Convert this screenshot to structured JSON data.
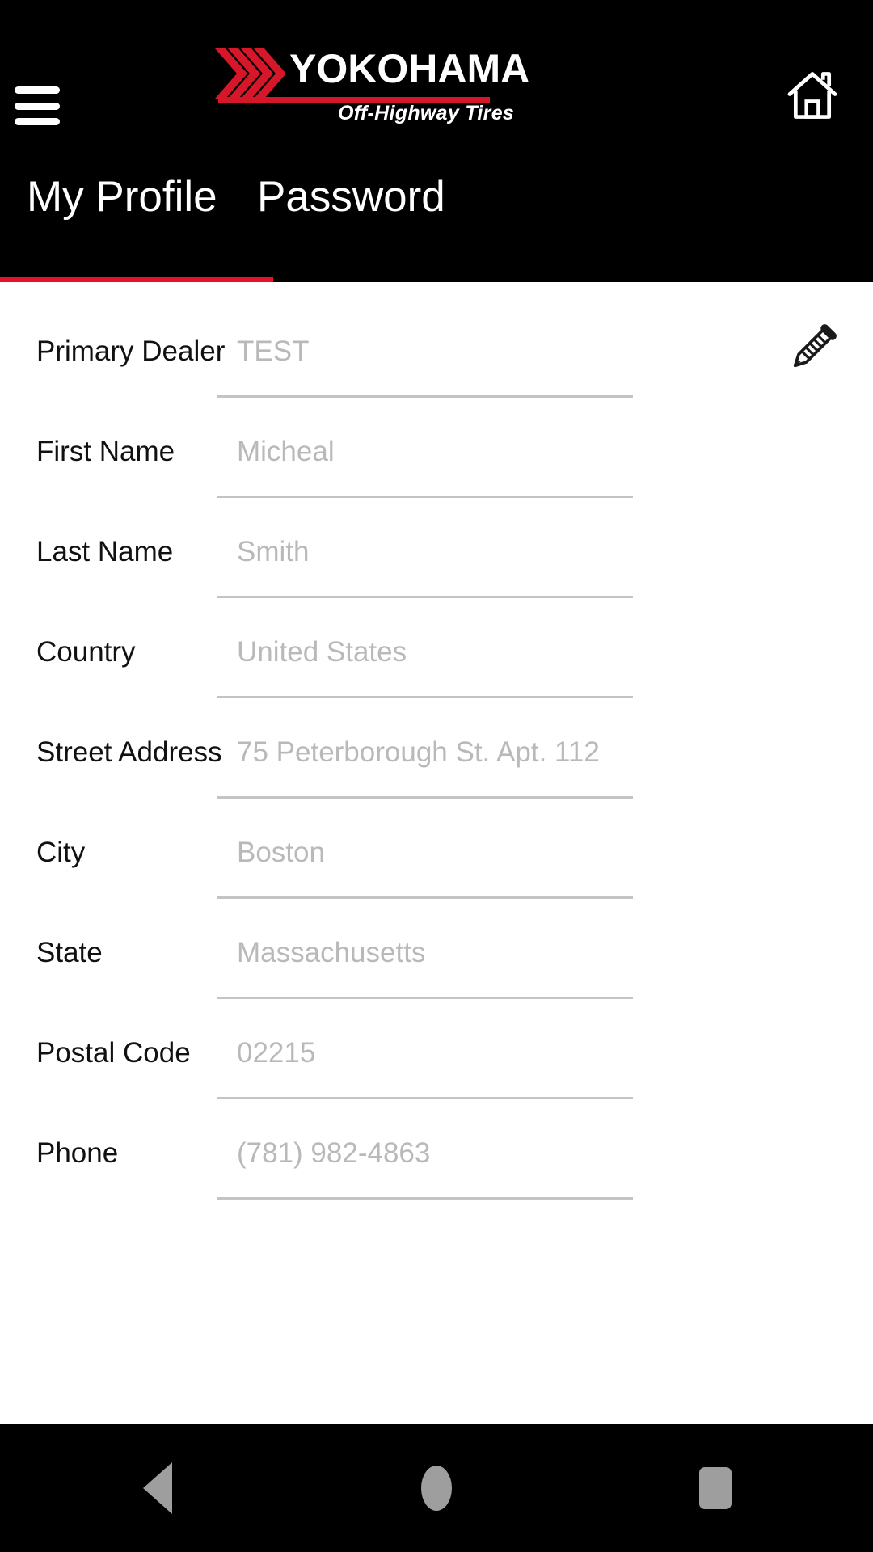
{
  "header": {
    "menu_icon": "hamburger-menu-icon",
    "home_icon": "home-icon",
    "logo": {
      "wordmark": "YOKOHAMA",
      "tagline": "Off-Highway Tires",
      "mark_color": "#d6172a"
    }
  },
  "tabs": {
    "items": [
      {
        "label": "My Profile",
        "active": true
      },
      {
        "label": "Password",
        "active": false
      }
    ],
    "indicator_color": "#e8112d"
  },
  "form": {
    "edit_icon": "pencil-icon",
    "fields": [
      {
        "label": "Primary Dealer",
        "value": "TEST",
        "editable": true
      },
      {
        "label": "First Name",
        "value": "Micheal",
        "editable": false
      },
      {
        "label": "Last Name",
        "value": "Smith",
        "editable": false
      },
      {
        "label": "Country",
        "value": "United States",
        "editable": false
      },
      {
        "label": "Street Address",
        "value": "75 Peterborough St. Apt. 112",
        "editable": false
      },
      {
        "label": "City",
        "value": "Boston",
        "editable": false
      },
      {
        "label": "State",
        "value": "Massachusetts",
        "editable": false
      },
      {
        "label": "Postal Code",
        "value": "02215",
        "editable": false
      },
      {
        "label": "Phone",
        "value": "(781) 982-4863",
        "editable": false
      }
    ]
  },
  "navbar": {
    "back_label": "back-icon",
    "home_label": "home-circle-icon",
    "recents_label": "recents-square-icon"
  }
}
